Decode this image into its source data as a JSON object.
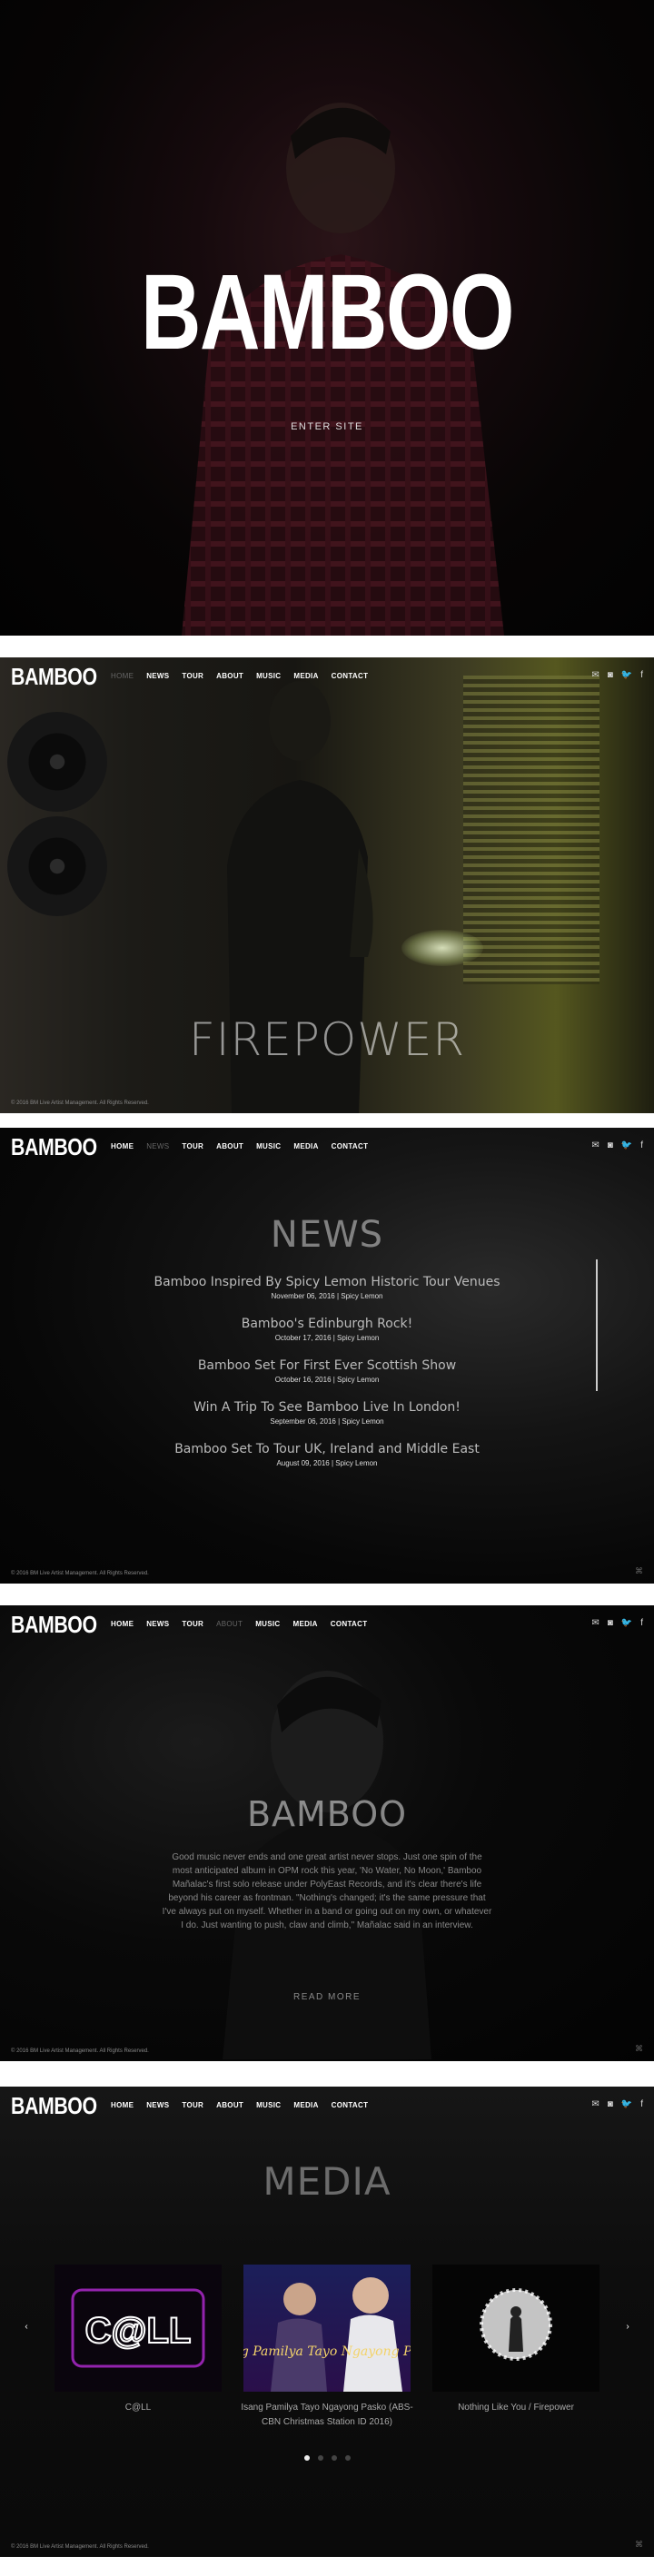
{
  "hero": {
    "title": "BAMBOO",
    "enter_label": "ENTER SITE"
  },
  "header": {
    "logo": "BAMBOO",
    "nav": [
      {
        "label": "HOME"
      },
      {
        "label": "NEWS"
      },
      {
        "label": "TOUR"
      },
      {
        "label": "ABOUT"
      },
      {
        "label": "MUSIC"
      },
      {
        "label": "MEDIA"
      },
      {
        "label": "CONTACT"
      }
    ],
    "social": [
      {
        "name": "mail-icon",
        "glyph": "✉"
      },
      {
        "name": "instagram-icon",
        "glyph": "◙"
      },
      {
        "name": "twitter-icon",
        "glyph": "🐦"
      },
      {
        "name": "facebook-icon",
        "glyph": "f"
      }
    ]
  },
  "firepower": {
    "title": "FIREPOWER",
    "footer": "© 2016 BM Live Artist Management. All Rights Reserved."
  },
  "news": {
    "title": "NEWS",
    "items": [
      {
        "headline": "Bamboo Inspired By Spicy Lemon Historic Tour Venues",
        "meta": "November 06, 2016 | Spicy Lemon"
      },
      {
        "headline": "Bamboo's Edinburgh Rock!",
        "meta": "October 17, 2016 | Spicy Lemon"
      },
      {
        "headline": "Bamboo Set For First Ever Scottish Show",
        "meta": "October 16, 2016 | Spicy Lemon"
      },
      {
        "headline": "Win A Trip To See Bamboo Live In London!",
        "meta": "September 06, 2016 | Spicy Lemon"
      },
      {
        "headline": "Bamboo Set To Tour UK, Ireland and Middle East",
        "meta": "August 09, 2016 | Spicy Lemon"
      }
    ],
    "footer": "© 2016 BM Live Artist Management. All Rights Reserved."
  },
  "about": {
    "title": "BAMBOO",
    "body": "Good music never ends and one great artist never stops. Just one spin of the most anticipated album in OPM rock this year, 'No Water, No Moon,' Bamboo Mañalac's first solo release under PolyEast Records, and it's clear there's life beyond his career as frontman. \"Nothing's changed; it's the same pressure that I've always put on myself. Whether in a band or going out on my own, or whatever I do. Just wanting to push, claw and climb,\" Mañalac said in an interview.",
    "read_more": "READ MORE",
    "footer": "© 2016 BM Live Artist Management. All Rights Reserved."
  },
  "media": {
    "title": "MEDIA",
    "items": [
      {
        "caption": "C@LL",
        "art": "C@LL"
      },
      {
        "caption": "Isang Pamilya Tayo Ngayong Pasko (ABS-CBN Christmas Station ID 2016)",
        "art": "Isang Pamilya Tayo Ngayong Pasko"
      },
      {
        "caption": "Nothing Like You / Firepower",
        "art": ""
      }
    ],
    "dots": 4,
    "active_dot": 0,
    "prev": "‹",
    "next": "›",
    "footer": "© 2016 BM Live Artist Management. All Rights Reserved."
  },
  "colors": {
    "background": "#050505",
    "text": "#ffffff",
    "accent_purple": "#b52bd6",
    "muted": "#888888"
  }
}
